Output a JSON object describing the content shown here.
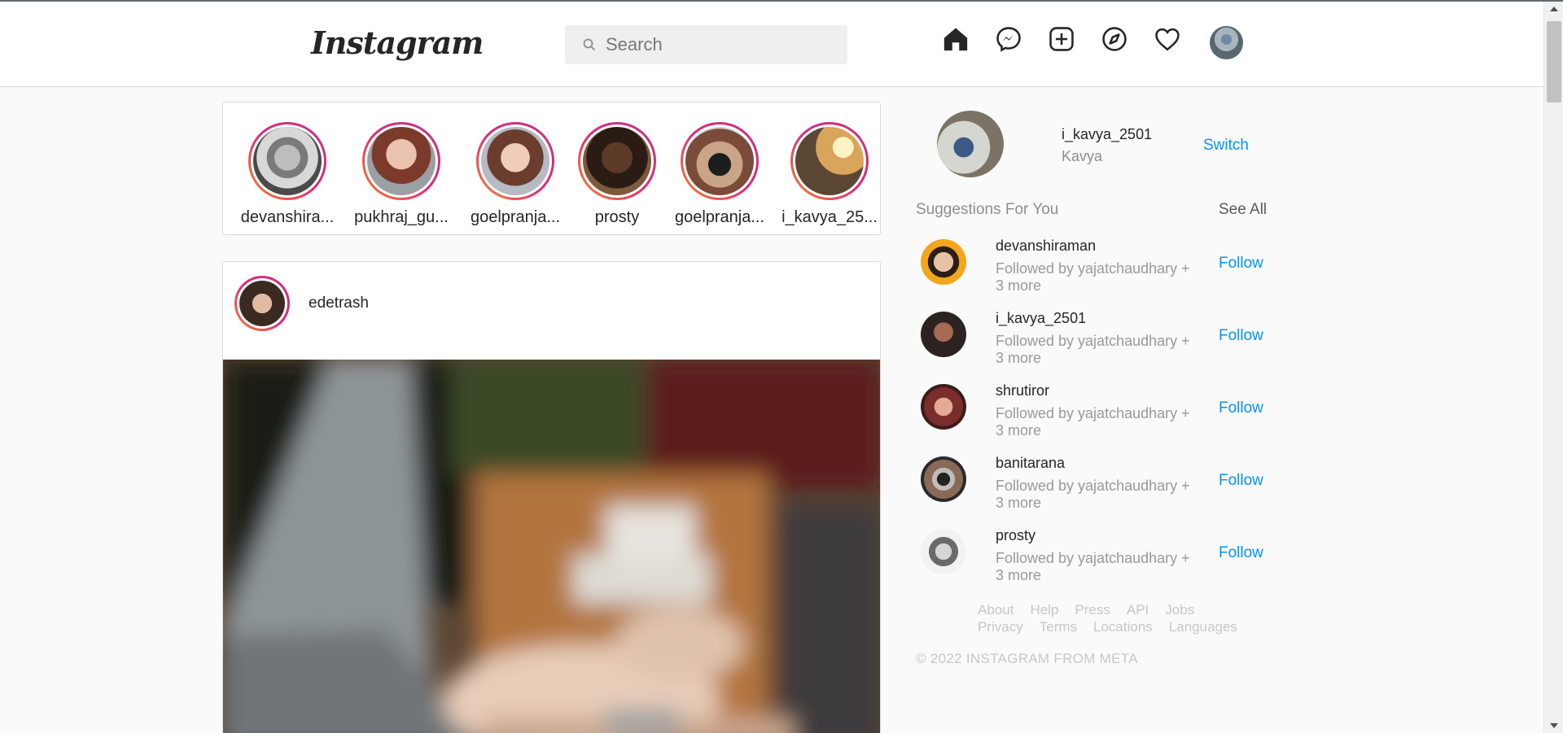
{
  "header": {
    "logo": "Instagram",
    "search_placeholder": "Search",
    "nav_icons": [
      "home-icon",
      "messenger-icon",
      "new-post-icon",
      "explore-icon",
      "activity-heart-icon"
    ]
  },
  "stories": [
    {
      "name": "devanshira..."
    },
    {
      "name": "pukhraj_gu..."
    },
    {
      "name": "goelpranja..."
    },
    {
      "name": "prosty"
    },
    {
      "name": "goelpranja..."
    },
    {
      "name": "i_kavya_25..."
    }
  ],
  "post": {
    "username": "edetrash"
  },
  "sidebar": {
    "username": "i_kavya_2501",
    "name": "Kavya",
    "switch_label": "Switch",
    "suggestions_title": "Suggestions For You",
    "see_all": "See All",
    "suggestions": [
      {
        "username": "devanshiraman",
        "sub": "Followed by yajatchaudhary + 3 more",
        "action": "Follow"
      },
      {
        "username": "i_kavya_2501",
        "sub": "Followed by yajatchaudhary + 3 more",
        "action": "Follow"
      },
      {
        "username": "shrutiror",
        "sub": "Followed by yajatchaudhary + 3 more",
        "action": "Follow"
      },
      {
        "username": "banitarana",
        "sub": "Followed by yajatchaudhary + 3 more",
        "action": "Follow"
      },
      {
        "username": "prosty",
        "sub": "Followed by yajatchaudhary + 3 more",
        "action": "Follow"
      }
    ],
    "footer_links_row1": [
      "About",
      "Help",
      "Press",
      "API",
      "Jobs"
    ],
    "footer_links_row2": [
      "Privacy",
      "Terms",
      "Locations",
      "Languages"
    ],
    "copyright": "© 2022 INSTAGRAM FROM META"
  },
  "colors": {
    "link_blue": "#0095f6",
    "story_ring_start": "#f58529",
    "story_ring_end": "#c13584"
  }
}
